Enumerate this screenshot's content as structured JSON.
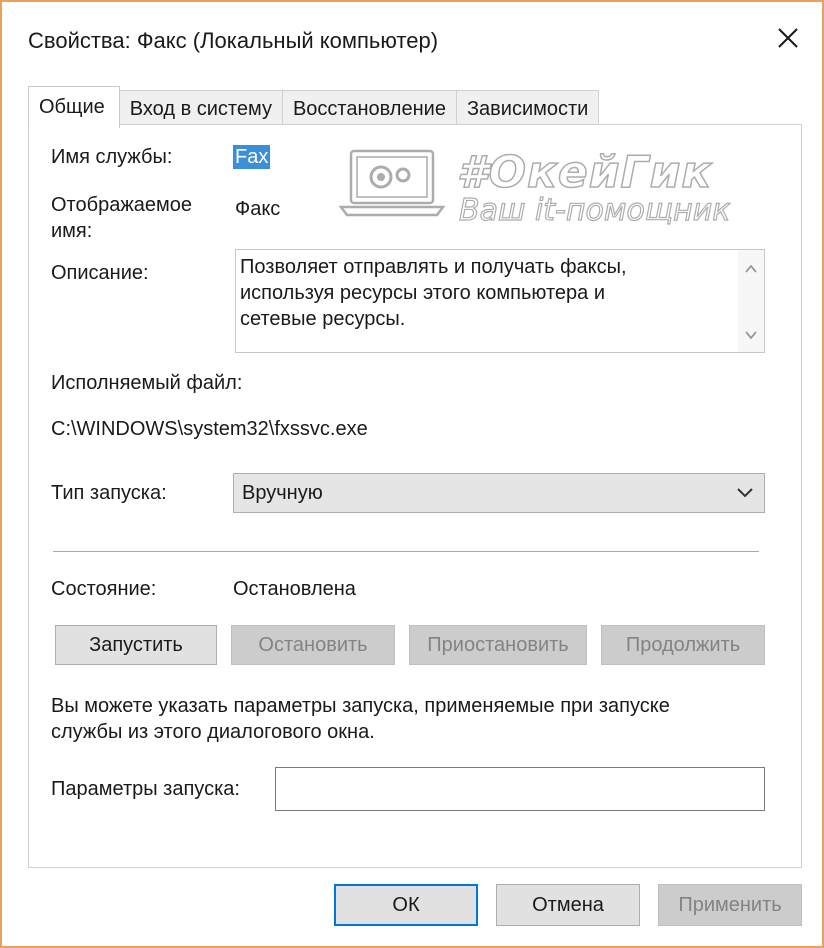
{
  "window": {
    "title": "Свойства: Факс (Локальный компьютер)"
  },
  "tabs": [
    {
      "label": "Общие",
      "active": true
    },
    {
      "label": "Вход в систему",
      "active": false
    },
    {
      "label": "Восстановление",
      "active": false
    },
    {
      "label": "Зависимости",
      "active": false
    }
  ],
  "general": {
    "service_name_label": "Имя службы:",
    "service_name_value": "Fax",
    "display_name_label_1": "Отображаемое",
    "display_name_label_2": "имя:",
    "display_name_value": "Факс",
    "description_label": "Описание:",
    "description_value": "Позволяет отправлять и получать факсы,\nиспользуя ресурсы этого компьютера и\nсетевые ресурсы.",
    "executable_label": "Исполняемый файл:",
    "executable_value": "C:\\WINDOWS\\system32\\fxssvc.exe",
    "startup_type_label": "Тип запуска:",
    "startup_type_value": "Вручную",
    "status_label": "Состояние:",
    "status_value": "Остановлена",
    "buttons": {
      "start": "Запустить",
      "stop": "Остановить",
      "pause": "Приостановить",
      "resume": "Продолжить"
    },
    "hint": "Вы можете указать параметры запуска, применяемые при запуске\nслужбы из этого диалогового окна.",
    "start_params_label": "Параметры запуска:",
    "start_params_value": ""
  },
  "footer": {
    "ok": "ОК",
    "cancel": "Отмена",
    "apply": "Применить"
  },
  "watermark": {
    "title": "#ОкейГик",
    "subtitle": "Ваш it-помощник"
  },
  "colors": {
    "frame_border": "#e9a05c",
    "selection": "#3b8fd8",
    "default_button_border": "#0078d7"
  }
}
